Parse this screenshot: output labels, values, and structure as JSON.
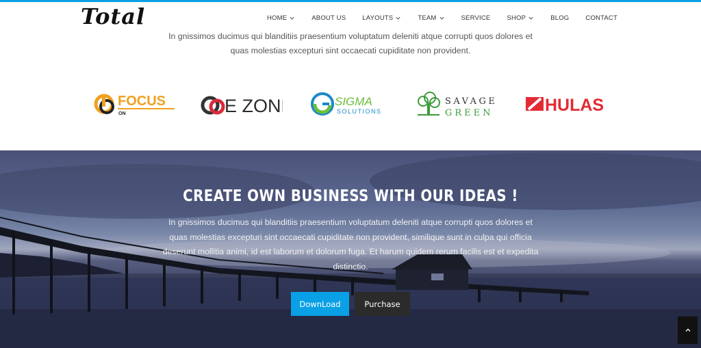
{
  "header": {
    "logo": "Total",
    "nav": [
      {
        "label": "HOME",
        "dropdown": true
      },
      {
        "label": "ABOUT US",
        "dropdown": false
      },
      {
        "label": "LAYOUTS",
        "dropdown": true
      },
      {
        "label": "TEAM",
        "dropdown": true
      },
      {
        "label": "SERVICE",
        "dropdown": false
      },
      {
        "label": "SHOP",
        "dropdown": true
      },
      {
        "label": "BLOG",
        "dropdown": false
      },
      {
        "label": "CONTACT",
        "dropdown": false
      }
    ]
  },
  "intro": {
    "text": "In gnissimos ducimus qui blanditiis praesentium voluptatum deleniti atque corrupti quos dolores et quas molestias excepturi sint occaecati cupiditate non provident."
  },
  "clients": [
    {
      "name": "FOCUS",
      "sub": "ON"
    },
    {
      "name": "E ZONE"
    },
    {
      "name": "SIGMA",
      "sub": "SOLUTIONS"
    },
    {
      "name": "SAVAGE",
      "sub": "GREEN"
    },
    {
      "name": "HULAS"
    }
  ],
  "banner": {
    "title": "CREATE OWN BUSINESS WITH OUR IDEAS !",
    "text": "In gnissimos ducimus qui blanditiis praesentium voluptatum deleniti atque corrupti quos dolores et quas molestias excepturi sint occaecati cupiditate non provident, similique sunt in culpa qui officia deserunt mollitia animi, id est laborum et dolorum fuga. Et harum quidem rerum facilis est et expedita distinctio.",
    "download_label": "DownLoad",
    "purchase_label": "Purchase"
  },
  "colors": {
    "accent": "#0aa0e6",
    "dark_button": "#2b2b2b",
    "focus_orange": "#f0a020",
    "hulas_red": "#e32b35",
    "savage_green": "#3a9a3a"
  },
  "icons": {
    "nav_dropdown": "chevron-down-icon",
    "back_to_top": "chevron-up-icon"
  }
}
